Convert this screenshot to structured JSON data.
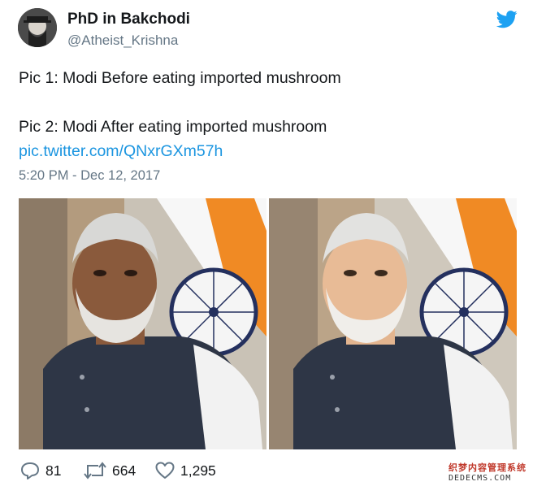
{
  "tweet": {
    "display_name": "PhD in Bakchodi",
    "handle": "@Atheist_Krishna",
    "lines": [
      "Pic 1: Modi Before eating imported mushroom",
      "Pic 2: Modi After eating imported mushroom"
    ],
    "link": "pic.twitter.com/QNxrGXm57h",
    "timestamp": "5:20 PM - Dec 12, 2017",
    "replies": "81",
    "retweets": "664",
    "likes": "1,295"
  },
  "icons": {
    "brand": "twitter-bird-icon",
    "reply": "reply-icon",
    "retweet": "retweet-icon",
    "like": "heart-icon"
  },
  "colors": {
    "brand": "#1da1f2",
    "link": "#1b95e0",
    "muted": "#657786"
  },
  "watermark": {
    "top": "织梦内容管理系统",
    "bottom": "DEDECMS.COM"
  }
}
